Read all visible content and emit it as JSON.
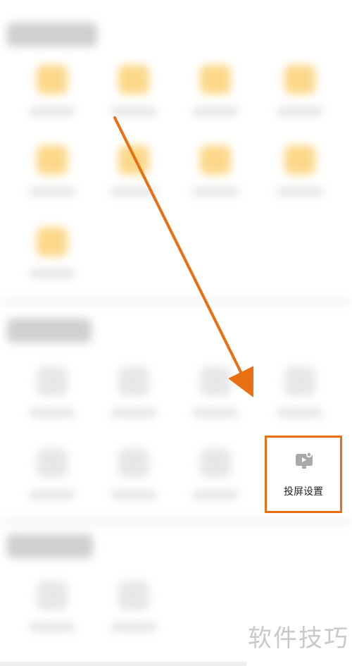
{
  "cast_settings": {
    "label": "投屏设置",
    "icon": "cast-screen-icon"
  },
  "watermark": "软件技巧",
  "annotation": {
    "arrow_color": "#e86f12",
    "box_color": "#e86f12"
  }
}
